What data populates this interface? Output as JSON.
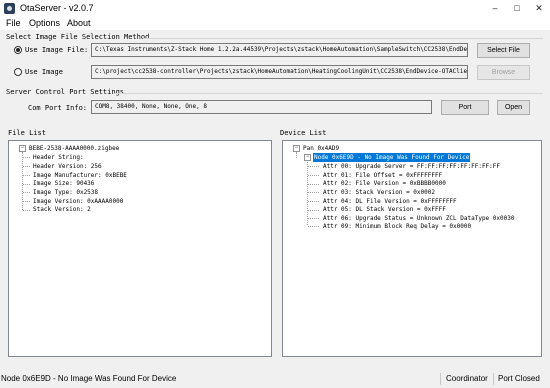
{
  "window": {
    "title": "OtaServer - v2.0.7",
    "minimize": "–",
    "maximize": "□",
    "close": "✕"
  },
  "menu": [
    "File",
    "Options",
    "About"
  ],
  "image_selection": {
    "heading": "Select Image File Selection Method",
    "use_image_file": {
      "label": "Use Image File:",
      "checked": true,
      "path": "C:\\Texas Instruments\\Z-Stack Home 1.2.2a.44539\\Projects\\zstack\\HomeAutomation\\SampleSwitch\\CC2538\\EndDe",
      "button": "Select File"
    },
    "use_image": {
      "label": "Use Image",
      "checked": false,
      "path": "C:\\project\\cc2538-controller\\Projects\\zstack\\HomeAutomation\\HeatingCoolingUnit\\CC2538\\EndDevice-OTAClie",
      "button": "Browse"
    }
  },
  "port_settings": {
    "heading": "Server Control Port Settings",
    "label": "Com Port Info:",
    "value": "COM8, 38400, None, None, One, 8",
    "port_button": "Port",
    "open_button": "Open"
  },
  "file_list": {
    "heading": "File List",
    "root": "BEBE-2538-AAAA0000.zigbee",
    "items": [
      "Header String:",
      "Header Version: 256",
      "Image Manufacturer: 0xBEBE",
      "Image Size: 90436",
      "Image Type: 0x2538",
      "Image Version: 0xAAAA0000",
      "Stack Version: 2"
    ]
  },
  "device_list": {
    "heading": "Device List",
    "pan": "Pan 0x4AD9",
    "node": "Node 0x6E9D - No Image Was Found For Device",
    "attrs": [
      "Attr 00: Upgrade Server = FF:FF:FF:FF:FF:FF:FF:FF",
      "Attr 01: File Offset = 0xFFFFFFFF",
      "Attr 02: File Version = 0xBBBB0000",
      "Attr 03: Stack Version = 0x0002",
      "Attr 04: DL File Version = 0xFFFFFFFF",
      "Attr 05: DL Stack Version = 0xFFFF",
      "Attr 06: Upgrade Status = Unknown ZCL DataType 0x0030",
      "Attr 09: Minimum Block Req Delay = 0x0000"
    ]
  },
  "status": {
    "message": "Node 0x6E9D - No Image Was Found For Device",
    "role": "Coordinator",
    "port_state": "Port Closed"
  }
}
